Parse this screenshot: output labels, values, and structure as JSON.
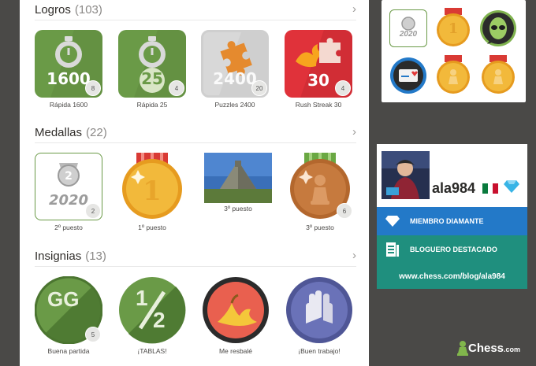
{
  "sections": {
    "logros": {
      "title": "Logros",
      "count": "(103)"
    },
    "medallas": {
      "title": "Medallas",
      "count": "(22)"
    },
    "insignias": {
      "title": "Insignias",
      "count": "(13)"
    }
  },
  "logros": [
    {
      "caption": "Rápida 1600",
      "number": "1600",
      "badge": "8",
      "icon": "stopwatch-icon"
    },
    {
      "caption": "Rápida 25",
      "number": "25",
      "badge": "4",
      "icon": "stopwatch-icon"
    },
    {
      "caption": "Puzzles 2400",
      "number": "2400",
      "badge": "20",
      "icon": "puzzle-icon"
    },
    {
      "caption": "Rush Streak 30",
      "number": "30",
      "badge": "4",
      "icon": "puzzle-fire-icon"
    }
  ],
  "medallas": [
    {
      "caption": "2º puesto",
      "number": "2020",
      "badge": "2",
      "medal_number": "2"
    },
    {
      "caption": "1º puesto",
      "medal_number": "1"
    },
    {
      "caption": "3º puesto"
    },
    {
      "caption": "3º puesto",
      "badge": "6",
      "icon": "pawn-icon"
    }
  ],
  "insignias": [
    {
      "caption": "Buena partida",
      "letters": "GG",
      "badge": "5"
    },
    {
      "caption": "¡TABLAS!",
      "fraction_top": "1",
      "fraction_bottom": "2"
    },
    {
      "caption": "Me resbalé",
      "icon": "banana-peel-icon"
    },
    {
      "caption": "¡Buen trabajo!",
      "icon": "high-five-icon"
    }
  ],
  "badge_box": {
    "items": [
      "trophy-2020-icon",
      "medal-1-icon",
      "alien-icon",
      "chat-bubble-icon",
      "medal-pawn-icon",
      "medal-pawn-icon"
    ],
    "year": "2020",
    "medal_number": "1"
  },
  "user": {
    "username": "ala984",
    "diamond_label": "MIEMBRO DIAMANTE",
    "blogger_label": "BLOGUERO DESTACADO",
    "blog_url": "www.chess.com/blog/ala984"
  },
  "logo": {
    "text": "Chess",
    "suffix": ".com"
  },
  "colors": {
    "green": "#6a9a47",
    "diamond_strip": "#2379c8",
    "blogger_strip": "#1f8f7e",
    "rush": "#e0323a",
    "gold": "#f0b63a",
    "bronze": "#c67a3e"
  }
}
